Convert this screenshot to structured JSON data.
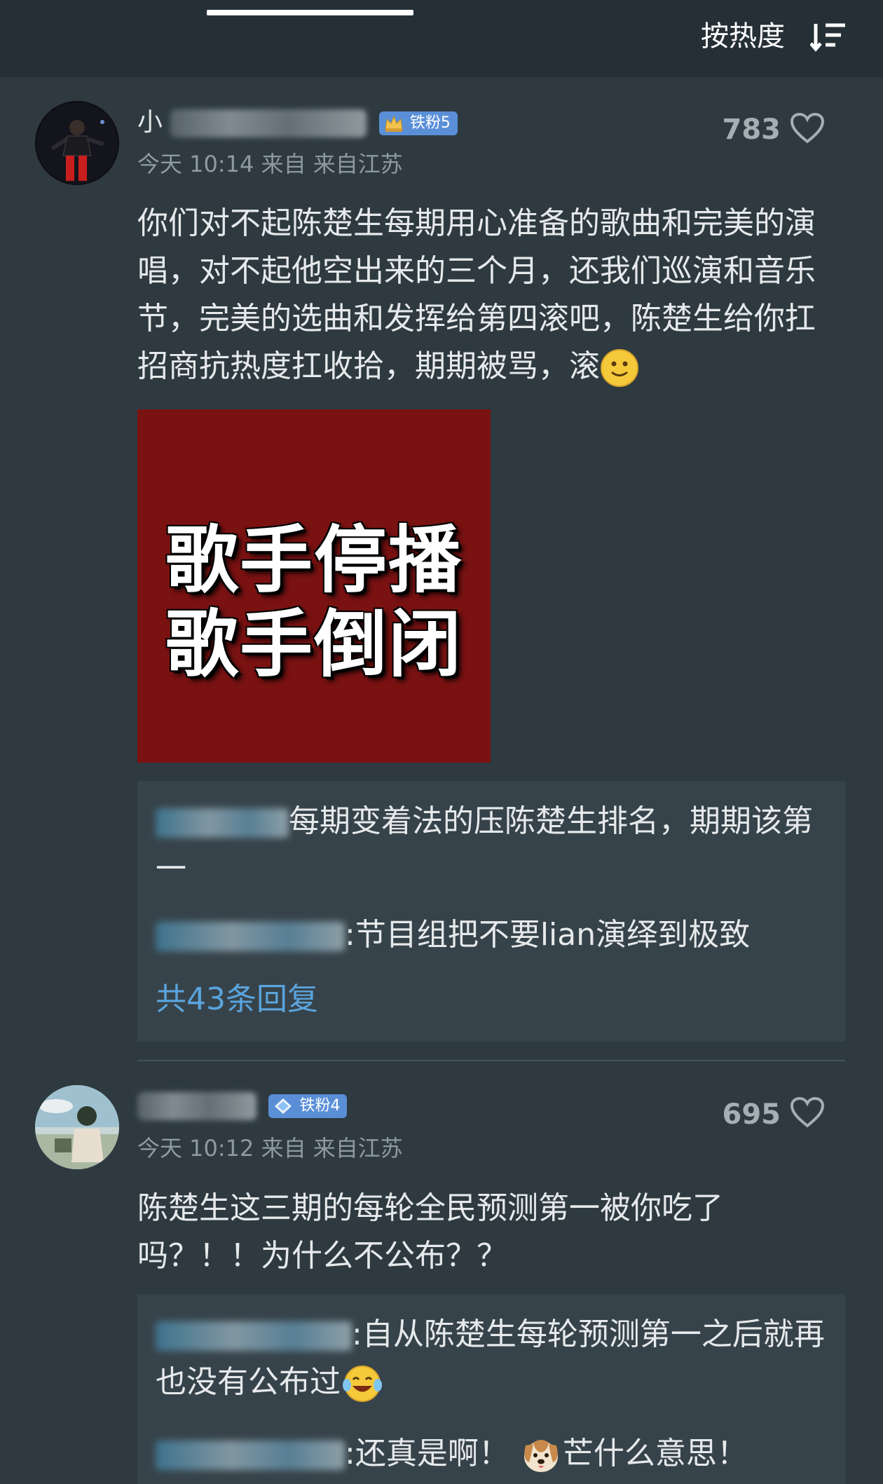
{
  "header": {
    "sort_label": "按热度",
    "sort_icon": "sort-icon"
  },
  "comments": [
    {
      "username_visible": "小",
      "badge": "铁粉5",
      "time": "今天 10:14 来自 来自江苏",
      "likes": "783",
      "text": "你们对不起陈楚生每期用心准备的歌曲和完美的演唱，对不起他空出来的三个月，还我们巡演和音乐节，完美的选曲和发挥给第四滚吧，陈楚生给你扛招商抗热度扛收拾，期期被骂，滚",
      "image": {
        "line1": "歌手停播",
        "line2": "歌手倒闭",
        "background": "#7a1212"
      },
      "replies": [
        {
          "text": "每期变着法的压陈楚生排名，期期该第一"
        },
        {
          "text": ":节目组把不要lian演绎到极致"
        }
      ],
      "reply_count": "共43条回复"
    },
    {
      "badge": "铁粉4",
      "time": "今天 10:12 来自 来自江苏",
      "likes": "695",
      "text": "陈楚生这三期的每轮全民预测第一被你吃了吗？！！为什么不公布？？",
      "replies": [
        {
          "text": ":自从陈楚生每轮预测第一之后就再也没有公布过"
        },
        {
          "text": ":还真是啊！",
          "text_after_emoji": "芒什么意思！"
        }
      ]
    }
  ],
  "colors": {
    "background": "#2e3a40",
    "reply_box": "#37434a",
    "link": "#5aa4dd",
    "badge": "#5a8fd8"
  }
}
